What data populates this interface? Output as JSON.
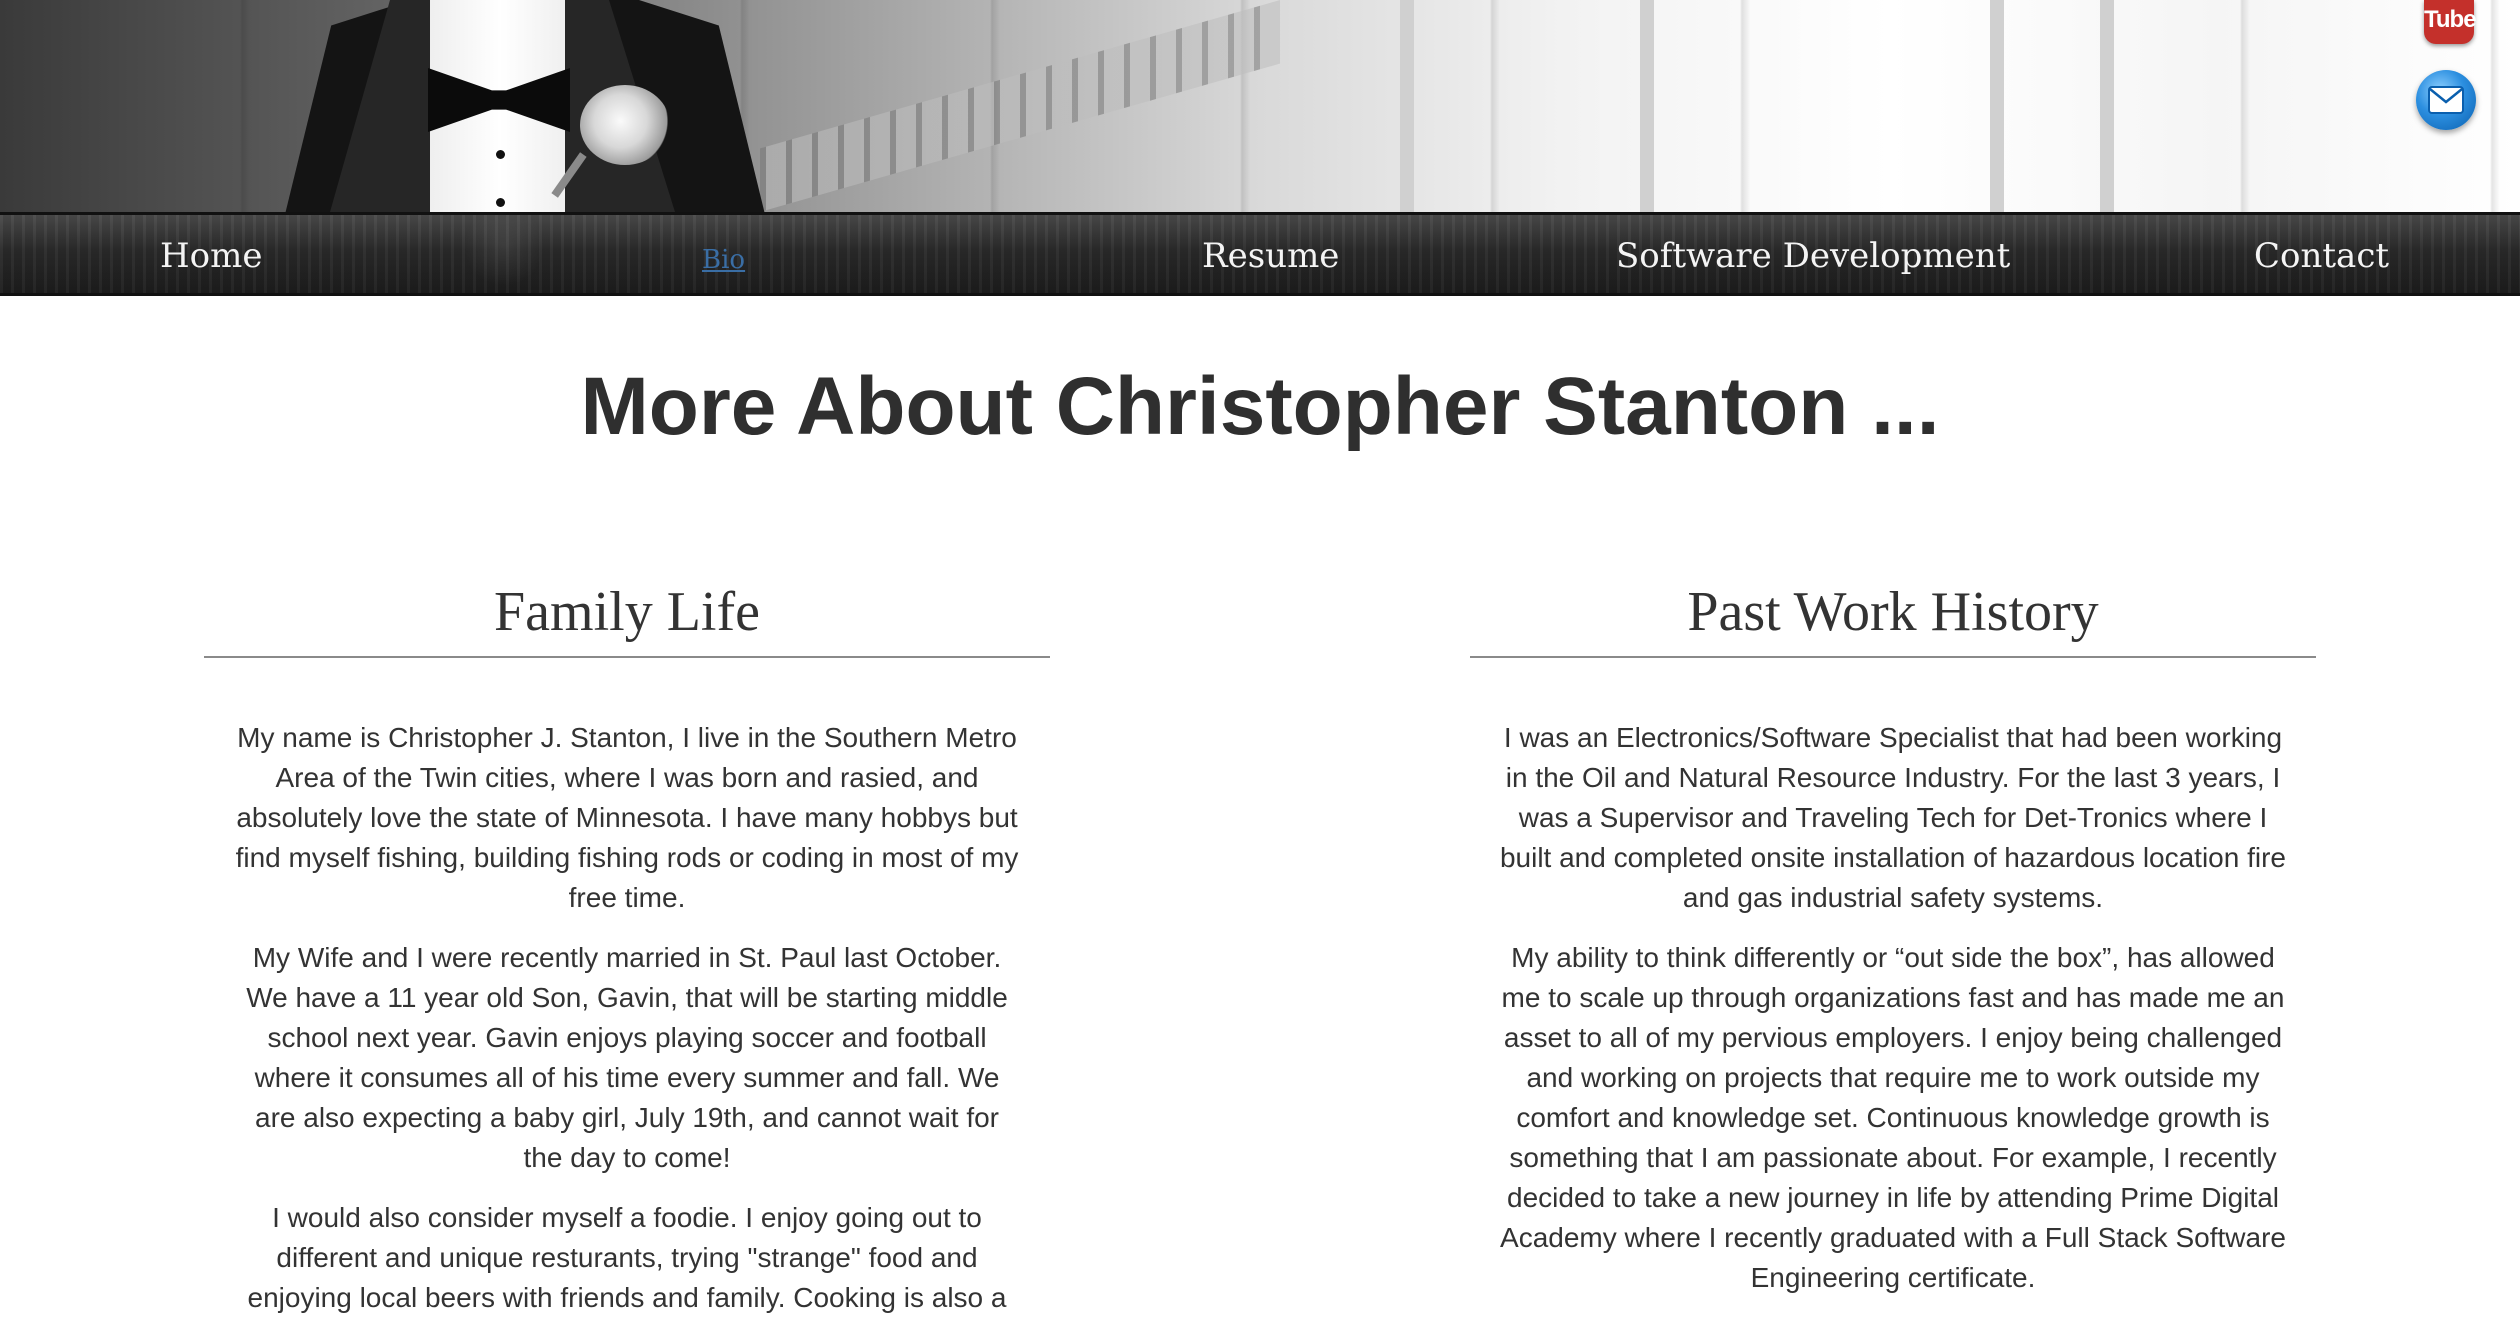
{
  "nav": {
    "items": [
      {
        "label": "Home"
      },
      {
        "label": "Bio"
      },
      {
        "label": "Resume"
      },
      {
        "label": "Software Development"
      },
      {
        "label": "Contact"
      }
    ]
  },
  "social": {
    "youtube_label": "Tube",
    "icons": [
      "youtube-icon",
      "mail-icon"
    ]
  },
  "page": {
    "title": "More About Christopher Stanton ..."
  },
  "sections": {
    "family": {
      "heading": "Family Life",
      "paragraphs": [
        "My name is Christopher J. Stanton, I live in the Southern Metro Area of the Twin cities, where I was born and rasied, and absolutely love the state of Minnesota. I have many hobbys but find myself fishing, building fishing rods or coding in most of my free time.",
        "My Wife and I were recently married in St. Paul last October. We have a 11 year old Son, Gavin, that will be starting middle school next year. Gavin enjoys playing soccer and football where it consumes all of his time every summer and fall. We are also expecting a baby girl, July 19th, and cannot wait for the day to come!",
        "I would also consider myself a foodie. I enjoy going out to different and unique resturants, trying \"strange\" food and enjoying local beers with friends and family. Cooking is also a"
      ]
    },
    "work": {
      "heading": "Past Work History",
      "paragraphs": [
        "I was an Electronics/Software Specialist that had been working in the Oil and Natural Resource Industry. For the last 3 years, I was a Supervisor and Traveling Tech for Det-Tronics where I built and completed onsite installation of hazardous location fire and gas industrial safety systems.",
        "My ability to think differently or “out side the box”, has allowed me to scale up through organizations fast and has made me an asset to all of my pervious employers. I enjoy being challenged and working on projects that require me to work outside my comfort and knowledge set. Continuous knowledge growth is something that I am passionate about. For example, I recently decided to take a new journey in life by attending Prime Digital Academy where I recently graduated with a Full Stack Software Engineering certificate."
      ]
    }
  },
  "colors": {
    "nav_text": "#f4f4f4",
    "nav_active": "#3a6ea5",
    "body_text": "#333333",
    "youtube_red": "#c4302b",
    "mail_blue": "#2c8fe0"
  }
}
